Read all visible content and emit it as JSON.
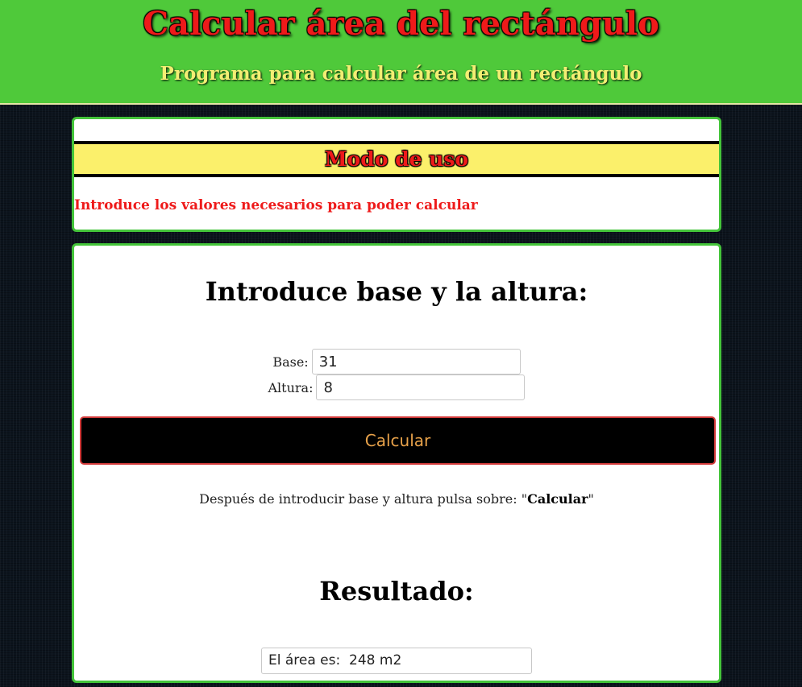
{
  "header": {
    "title": "Calcular área del rectángulo",
    "subtitle": "Programa para calcular área de un rectángulo"
  },
  "usage": {
    "title": "Modo de uso",
    "text": "Introduce los valores necesarios para poder calcular"
  },
  "form": {
    "title": "Introduce base y la altura:",
    "base_label": "Base:",
    "base_value": "31",
    "altura_label": "Altura:",
    "altura_value": "8",
    "calculate_label": "Calcular",
    "hint_prefix": "Después de introducir base y altura pulsa sobre: \"",
    "hint_bold": "Calcular",
    "hint_suffix": "\""
  },
  "result": {
    "title": "Resultado:",
    "output": "El área es:  248 m2"
  },
  "colors": {
    "header_bg": "#4fc93a",
    "title_red": "#ee1a1a",
    "subtitle_yellow": "#f3ee73",
    "usage_band": "#fbf06b",
    "card_border": "#44c43a",
    "button_bg": "#000000",
    "button_text": "#e8a24a"
  }
}
